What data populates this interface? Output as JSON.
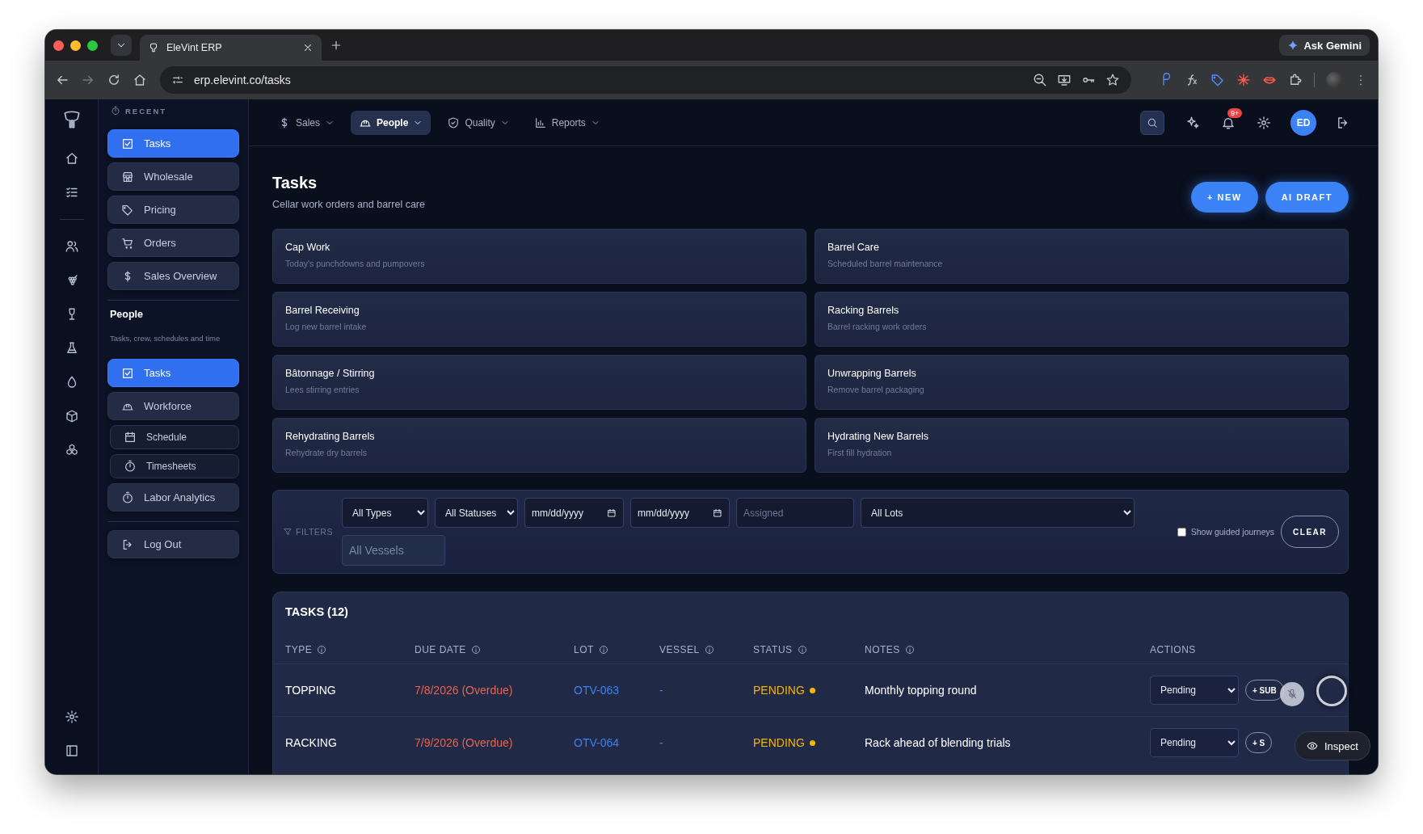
{
  "browser": {
    "tab_title": "EleVint ERP",
    "url": "erp.elevint.co/tasks",
    "assistant_button": "Ask Gemini"
  },
  "sidebar": {
    "recent_label": "RECENT",
    "recent_items": [
      {
        "label": "Tasks",
        "selected": true,
        "kind": "main"
      },
      {
        "label": "Wholesale",
        "selected": false,
        "kind": "main"
      },
      {
        "label": "Pricing",
        "selected": false,
        "kind": "main"
      },
      {
        "label": "Orders",
        "selected": false,
        "kind": "main"
      },
      {
        "label": "Sales Overview",
        "selected": false,
        "kind": "main"
      }
    ],
    "section_title": "People",
    "section_description": "Tasks, crew, schedules and time",
    "section_items": [
      {
        "label": "Tasks",
        "selected": true,
        "kind": "main"
      },
      {
        "label": "Workforce",
        "selected": false,
        "kind": "main"
      },
      {
        "label": "Schedule",
        "selected": false,
        "kind": "sub"
      },
      {
        "label": "Timesheets",
        "selected": false,
        "kind": "sub"
      },
      {
        "label": "Labor Analytics",
        "selected": false,
        "kind": "main"
      }
    ],
    "logout": "Log Out"
  },
  "topnav": {
    "items": [
      {
        "label": "Sales",
        "selected": false
      },
      {
        "label": "People",
        "selected": true
      },
      {
        "label": "Quality",
        "selected": false
      },
      {
        "label": "Reports",
        "selected": false
      }
    ],
    "notification_badge": "9+",
    "avatar": "ED"
  },
  "page": {
    "title": "Tasks",
    "subtitle": "Cellar work orders and barrel care",
    "buttons": [
      "+ NEW",
      "AI DRAFT"
    ]
  },
  "cards": [
    {
      "title": "Cap Work",
      "subtitle": "Today's punchdowns and pumpovers"
    },
    {
      "title": "Barrel Care",
      "subtitle": "Scheduled barrel maintenance"
    },
    {
      "title": "Barrel Receiving",
      "subtitle": "Log new barrel intake"
    },
    {
      "title": "Racking Barrels",
      "subtitle": "Barrel racking work orders"
    },
    {
      "title": "Bâtonnage / Stirring",
      "subtitle": "Lees stirring entries"
    },
    {
      "title": "Unwrapping Barrels",
      "subtitle": "Remove barrel packaging"
    },
    {
      "title": "Rehydrating Barrels",
      "subtitle": "Rehydrate dry barrels"
    },
    {
      "title": "Hydrating New Barrels",
      "subtitle": "First fill hydration"
    }
  ],
  "filters": {
    "label": "FILTERS",
    "type": "All Types",
    "status": "All Statuses",
    "date_from": "mm/dd/yyyy",
    "date_to": "mm/dd/yyyy",
    "assigned_placeholder": "Assigned",
    "lots": "All Lots",
    "vessels_placeholder": "All Vessels",
    "guided": {
      "label": "Show guided journeys",
      "checked": false
    },
    "clear": "CLEAR"
  },
  "table": {
    "title": "TASKS (12)",
    "columns": [
      {
        "label": "TYPE",
        "info": true
      },
      {
        "label": "DUE DATE",
        "info": true
      },
      {
        "label": "LOT",
        "info": true
      },
      {
        "label": "VESSEL",
        "info": true
      },
      {
        "label": "STATUS",
        "info": true
      },
      {
        "label": "NOTES",
        "info": true
      },
      {
        "label": "ACTIONS",
        "info": false
      }
    ],
    "rows": [
      {
        "type": "TOPPING",
        "due": "7/8/2026 (Overdue)",
        "overdue": true,
        "lot": "OTV-063",
        "vessel": "-",
        "status": "PENDING",
        "color": "#f5b50b",
        "notes": "Monthly topping round",
        "action": "Pending",
        "sub": "+ SUB"
      },
      {
        "type": "RACKING",
        "due": "7/9/2026 (Overdue)",
        "overdue": true,
        "lot": "OTV-064",
        "vessel": "-",
        "status": "PENDING",
        "color": "#f5b50b",
        "notes": "Rack ahead of blending trials",
        "action": "Pending",
        "sub": "+ S"
      }
    ]
  },
  "inspect_button": "Inspect"
}
